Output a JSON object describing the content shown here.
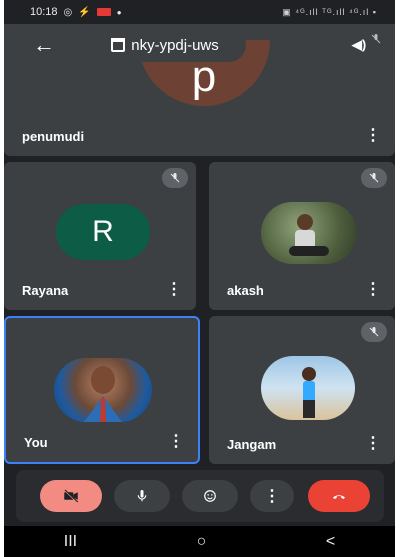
{
  "status_bar": {
    "time": "10:18",
    "right_text": "▣ ⁴ᴳ.ıll ᵀᴳ.ıll ⁴ᴳ.ıl ▪"
  },
  "meeting": {
    "code": "nky-ypdj-uws"
  },
  "participants": [
    {
      "name": "penumudi",
      "initial": "p",
      "avatar_color": "#6d4235",
      "muted": true
    },
    {
      "name": "Rayana",
      "initial": "R",
      "avatar_color": "#0d5c45",
      "muted": true
    },
    {
      "name": "akash",
      "muted": true,
      "photo": true
    },
    {
      "name": "You",
      "photo": true,
      "self": true
    },
    {
      "name": "Jangam",
      "muted": true,
      "photo": true
    }
  ],
  "colors": {
    "end_call": "#ea4335",
    "camera_off": "#f28b82",
    "active_border": "#3b82f6"
  },
  "controls": [
    "camera-off-icon",
    "mic-icon",
    "emoji-icon",
    "more-vert-icon",
    "end-call-icon"
  ],
  "nav": {
    "recents": "III",
    "home": "○",
    "back": "<"
  }
}
